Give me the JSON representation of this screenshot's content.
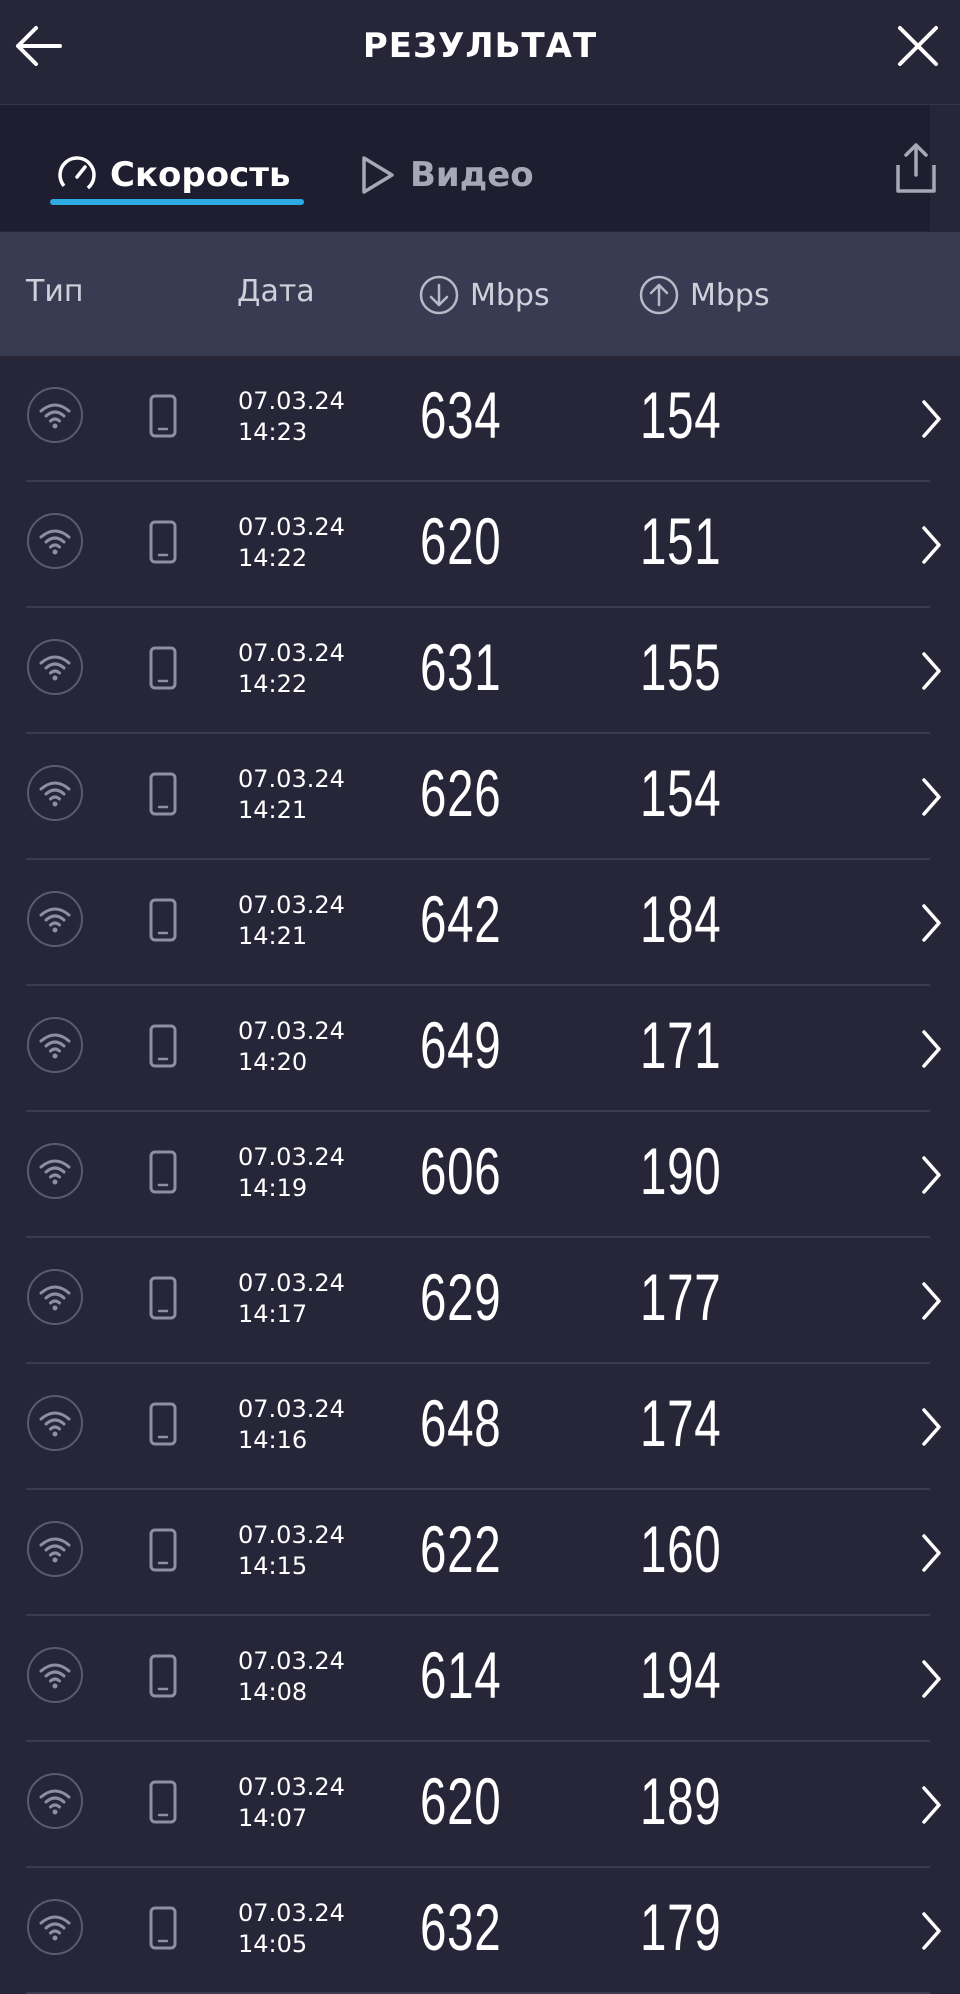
{
  "header": {
    "title": "РЕЗУЛЬТАТ"
  },
  "tabs": [
    {
      "label": "Скорость",
      "icon": "speedometer-icon",
      "active": true
    },
    {
      "label": "Видео",
      "icon": "play-icon",
      "active": false
    }
  ],
  "columns": {
    "type": "Тип",
    "date": "Дата",
    "download": "Mbps",
    "upload": "Mbps"
  },
  "colors": {
    "accent": "#2eaae3",
    "background": "#262638"
  },
  "results": [
    {
      "date": "07.03.24",
      "time": "14:23",
      "down": "634",
      "up": "154"
    },
    {
      "date": "07.03.24",
      "time": "14:22",
      "down": "620",
      "up": "151"
    },
    {
      "date": "07.03.24",
      "time": "14:22",
      "down": "631",
      "up": "155"
    },
    {
      "date": "07.03.24",
      "time": "14:21",
      "down": "626",
      "up": "154"
    },
    {
      "date": "07.03.24",
      "time": "14:21",
      "down": "642",
      "up": "184"
    },
    {
      "date": "07.03.24",
      "time": "14:20",
      "down": "649",
      "up": "171"
    },
    {
      "date": "07.03.24",
      "time": "14:19",
      "down": "606",
      "up": "190"
    },
    {
      "date": "07.03.24",
      "time": "14:17",
      "down": "629",
      "up": "177"
    },
    {
      "date": "07.03.24",
      "time": "14:16",
      "down": "648",
      "up": "174"
    },
    {
      "date": "07.03.24",
      "time": "14:15",
      "down": "622",
      "up": "160"
    },
    {
      "date": "07.03.24",
      "time": "14:08",
      "down": "614",
      "up": "194"
    },
    {
      "date": "07.03.24",
      "time": "14:07",
      "down": "620",
      "up": "189"
    },
    {
      "date": "07.03.24",
      "time": "14:05",
      "down": "632",
      "up": "179"
    }
  ]
}
